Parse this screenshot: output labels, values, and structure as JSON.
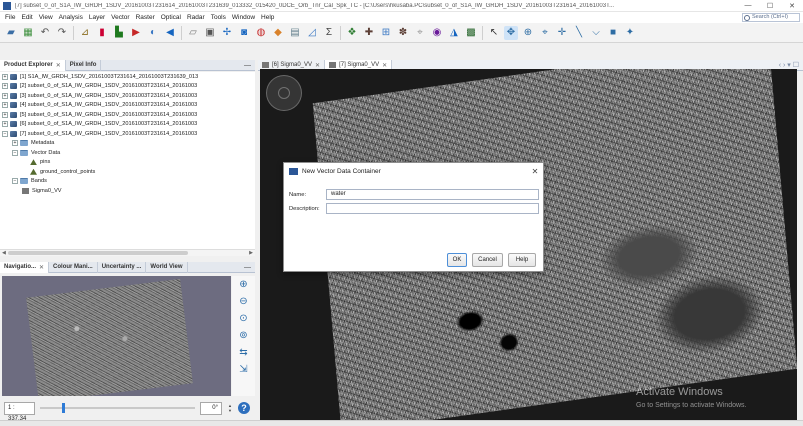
{
  "window": {
    "title": "[7] subset_0_of_S1A_IW_GRDH_1SDV_20161003T231614_20161003T231639_013332_015420_0DCE_Orb_Tnr_Cal_Spk_TC - [C:\\Users\\hkusaba.PC\\subset_0_of_S1A_IW_GRDH_1SDV_20161003T231614_20161003T..."
  },
  "menu": [
    "File",
    "Edit",
    "View",
    "Analysis",
    "Layer",
    "Vector",
    "Raster",
    "Optical",
    "Radar",
    "Tools",
    "Window",
    "Help"
  ],
  "search_placeholder": "Search (Ctrl+I)",
  "left_tabs": {
    "product_explorer": "Product Explorer",
    "pixel_info": "Pixel Info"
  },
  "tree": {
    "products": [
      "[1] S1A_IW_GRDH_1SDV_20161003T231614_20161003T231639_013",
      "[2] subset_0_of_S1A_IW_GRDH_1SDV_20161003T231614_20161003",
      "[3] subset_0_of_S1A_IW_GRDH_1SDV_20161003T231614_20161003",
      "[4] subset_0_of_S1A_IW_GRDH_1SDV_20161003T231614_20161003",
      "[5] subset_0_of_S1A_IW_GRDH_1SDV_20161003T231614_20161003",
      "[6] subset_0_of_S1A_IW_GRDH_1SDV_20161003T231614_20161003",
      "[7] subset_0_of_S1A_IW_GRDH_1SDV_20161003T231614_20161003"
    ],
    "metadata": "Metadata",
    "vector_data": "Vector Data",
    "pins": "pins",
    "gcp": "ground_control_points",
    "bands": "Bands",
    "band": "Sigma0_VV"
  },
  "nav_tabs": {
    "navigation": "Navigatio...",
    "colour": "Colour Mani...",
    "uncertainty": "Uncertainty ...",
    "world": "World View"
  },
  "nav": {
    "scale": "1 : 337.34",
    "rotation": "0°"
  },
  "doc_tabs": {
    "tab1": "[6] Sigma0_VV",
    "tab2": "[7] Sigma0_VV"
  },
  "dialog": {
    "title": "New Vector Data Container",
    "name_label": "Name:",
    "name_value": "water",
    "description_label": "Description:",
    "description_value": "",
    "ok": "OK",
    "cancel": "Cancel",
    "help": "Help"
  },
  "watermark": {
    "line1": "Activate Windows",
    "line2": "Go to Settings to activate Windows."
  }
}
